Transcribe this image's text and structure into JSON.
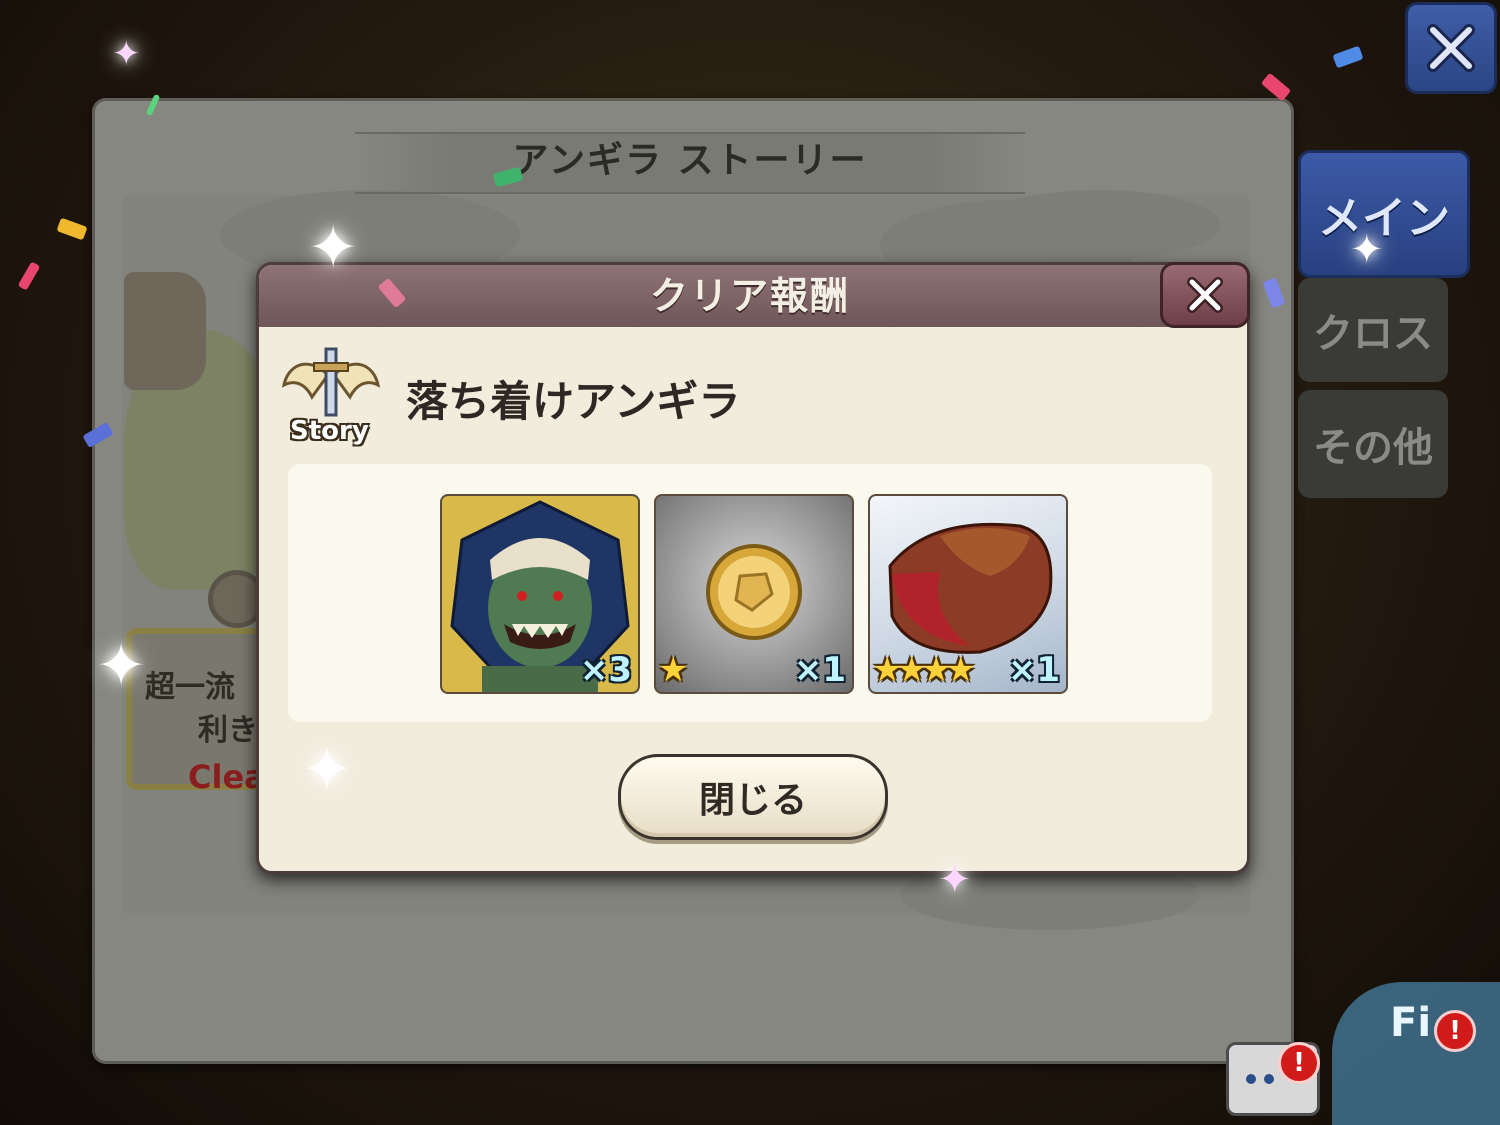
{
  "background_title": "アンギラ ストーリー",
  "side_tabs": {
    "main": "メイン",
    "cross": "クロス",
    "other": "その他"
  },
  "quest_card": {
    "line1": "超一流",
    "line2": "利き",
    "status": "Clea"
  },
  "modal": {
    "title": "クリア報酬",
    "badge_label": "Story",
    "quest_name": "落ち着けアンギラ",
    "rewards": [
      {
        "name": "orc-monster",
        "quantity": "×3",
        "stars": ""
      },
      {
        "name": "gold-coin",
        "quantity": "×1",
        "stars": "★"
      },
      {
        "name": "meat",
        "quantity": "×1",
        "stars": "★★★★"
      }
    ],
    "close_label": "閉じる"
  },
  "field_button": {
    "label": "Fi"
  },
  "alerts": {
    "chat": "!",
    "field": "!"
  },
  "icons": {
    "top_close": "close-icon",
    "modal_close": "close-icon",
    "story": "sword-wings-icon",
    "chat": "chat-bubble-icon"
  },
  "colors": {
    "modal_header": "#7e6467",
    "tab_active": "#334f96",
    "alert": "#d11b1b"
  }
}
